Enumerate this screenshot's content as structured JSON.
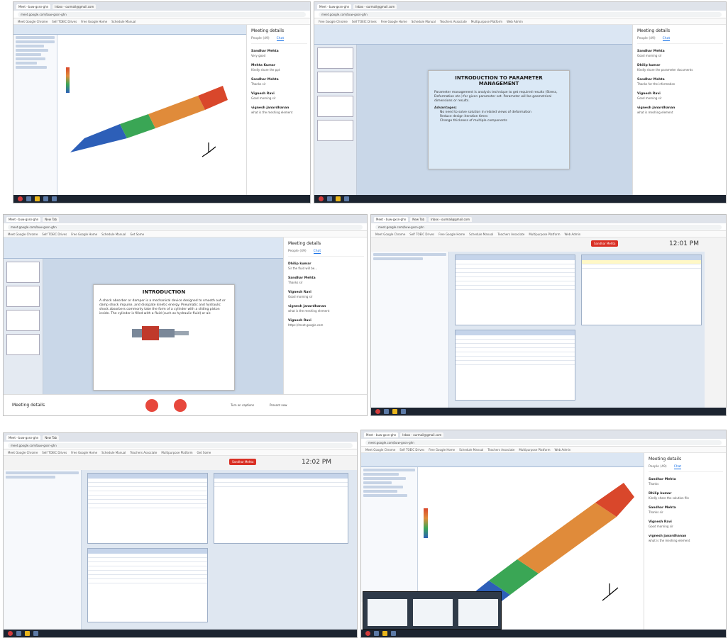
{
  "panels": {
    "p1": {
      "tabs": [
        "Meet - buw-gxsn-ghn",
        "Inbox - ourmail@gmail.com"
      ],
      "url": "meet.google.com/buw-gxsn-ghn",
      "bookmarks": [
        "Meet Google Chrome",
        "Self TOEIC Drives",
        "Free Google Home",
        "Schedule Manual"
      ],
      "side_title": "Meeting details",
      "side_tabs": [
        "People (49)",
        "Chat"
      ],
      "messages": [
        {
          "name": "Sandhar Mehta",
          "text": "Very good"
        },
        {
          "name": "Mehta Kumar",
          "text": "Kindly share the ppt"
        },
        {
          "name": "Sandhar Mehta",
          "text": "Thanks sir"
        },
        {
          "name": "Vignesh Ravi",
          "text": "Good morning sir"
        },
        {
          "name": "vignesh janardhanan",
          "text": "what is the meshing element"
        }
      ]
    },
    "p2": {
      "tabs": [
        "Meet - buw-gxsn-ghn",
        "Inbox - ourmail@gmail.com"
      ],
      "url": "meet.google.com/buw-gxsn-ghn",
      "bookmarks": [
        "Free Google Chrome",
        "Self TOEIC Drives",
        "Free Google Home",
        "Schedule Manual",
        "Teachers Associate",
        "Multipurpose Platform",
        "Web Admin"
      ],
      "slide_title": "INTRODUCTION TO PARAMETER MANAGEMENT",
      "slide_text_1": "Parameter management is analysis technique to get required results (Stress, Deformation etc.) for given parameter set. Parameter will be geometrical dimensions or results.",
      "slide_sub": "Advantages:",
      "slide_bullets": [
        "No need to solve solution in related views of deformation",
        "Reduce design iteration times",
        "Change thickness of multiple components"
      ],
      "side_title": "Meeting details",
      "side_tabs": [
        "People (49)",
        "Chat"
      ],
      "messages": [
        {
          "name": "Sandhar Mehta",
          "text": "Good morning sir"
        },
        {
          "name": "Dhilip kumar",
          "text": "Kindly share the parameter documents"
        },
        {
          "name": "Sandhar Mehta",
          "text": "Thanks for the information"
        },
        {
          "name": "Vignesh Ravi",
          "text": "Good morning sir"
        },
        {
          "name": "vignesh janardhanan",
          "text": "what is meshing element"
        }
      ]
    },
    "p3": {
      "tabs": [
        "Meet - buw-gxsn-ghn",
        "New Tab"
      ],
      "url": "meet.google.com/buw-gxsn-ghn",
      "bookmarks": [
        "Meet Google Chrome",
        "Self TOEIC Drives",
        "Free Google Home",
        "Schedule Manual",
        "Get Some"
      ],
      "slide_title": "INTRODUCTION",
      "slide_text": "A shock absorber or damper is a mechanical device designed to smooth out or damp shock impulse, and dissipate kinetic energy. Pneumatic and hydraulic shock absorbers commonly take the form of a cylinder with a sliding piston inside. The cylinder is filled with a fluid (such as hydraulic fluid) or air.",
      "side_title": "Meeting details",
      "side_tabs": [
        "People (49)",
        "Chat"
      ],
      "messages": [
        {
          "name": "Dhilip kumar",
          "text": "Sir the fluid will be..."
        },
        {
          "name": "Sandhar Mehta",
          "text": "Thanks sir"
        },
        {
          "name": "Vignesh Ravi",
          "text": "Good morning sir"
        },
        {
          "name": "vignesh janardhanan",
          "text": "what is the meshing element"
        },
        {
          "name": "Vignesh Ravi",
          "text": "https://meet.google.com"
        }
      ],
      "meeting_details": "Meeting details",
      "meet_actions": [
        "Turn on captions",
        "Present now"
      ]
    },
    "p4": {
      "tabs": [
        "Meet - buw-gxsn-ghn",
        "New Tab",
        "Inbox - ourmail@gmail.com"
      ],
      "url": "meet.google.com/buw-gxsn-ghn",
      "bookmarks": [
        "Meet Google Chrome",
        "Self TOEIC Drives",
        "Free Google Home",
        "Schedule Manual",
        "Teachers Associate",
        "Multipurpose Platform",
        "Web Admin"
      ],
      "user_chip": "Sandhar Mehta",
      "clock": "12:01 PM"
    },
    "p5": {
      "tabs": [
        "Meet - buw-gxsn-ghn",
        "New Tab"
      ],
      "url": "meet.google.com/buw-gxsn-ghn",
      "bookmarks": [
        "Meet Google Chrome",
        "Self TOEIC Drives",
        "Free Google Home",
        "Schedule Manual",
        "Teachers Associate",
        "Multipurpose Platform",
        "Get Some"
      ],
      "user_chip": "Sandhar Mehta",
      "clock": "12:02 PM"
    },
    "p6": {
      "tabs": [
        "Meet - buw-gxsn-ghn",
        "Inbox - ourmail@gmail.com"
      ],
      "url": "meet.google.com/buw-gxsn-ghn",
      "bookmarks": [
        "Meet Google Chrome",
        "Self TOEIC Drives",
        "Free Google Home",
        "Schedule Manual",
        "Teachers Associate",
        "Multipurpose Platform",
        "Web Admin"
      ],
      "side_title": "Meeting details",
      "side_tabs": [
        "People (49)",
        "Chat"
      ],
      "messages": [
        {
          "name": "Sandhar Mehta",
          "text": "Thanks"
        },
        {
          "name": "Dhilip kumar",
          "text": "Kindly share the solution file"
        },
        {
          "name": "Sandhar Mehta",
          "text": "Thanks sir"
        },
        {
          "name": "Vignesh Ravi",
          "text": "Good morning sir"
        },
        {
          "name": "vignesh janardhanan",
          "text": "what is the meshing element"
        }
      ]
    }
  },
  "colors": {
    "beam_blue": "#2d5fb8",
    "beam_green": "#3aa655",
    "beam_orange": "#e08b3a",
    "beam_red": "#d9472b",
    "taskbar": "#1c2430",
    "ribbon": "#dbe6f3"
  }
}
